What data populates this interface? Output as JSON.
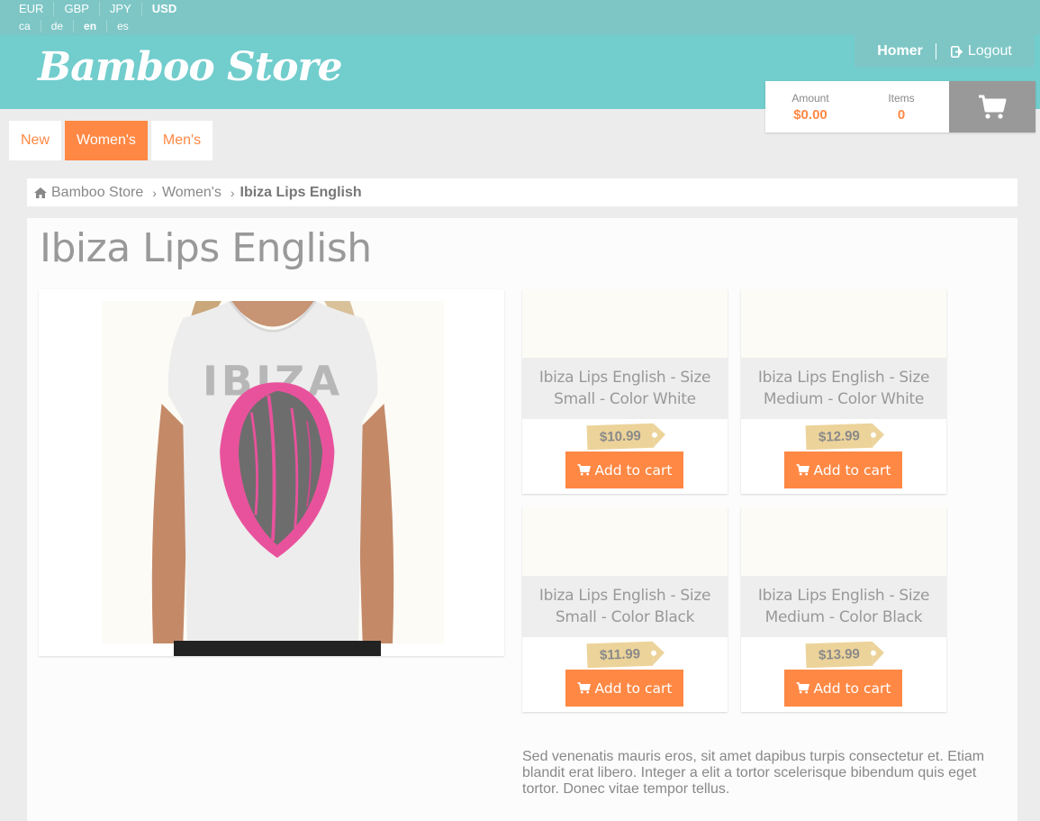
{
  "currencies": [
    {
      "label": "EUR",
      "active": false
    },
    {
      "label": "GBP",
      "active": false
    },
    {
      "label": "JPY",
      "active": false
    },
    {
      "label": "USD",
      "active": true
    }
  ],
  "languages": [
    {
      "label": "ca",
      "active": false
    },
    {
      "label": "de",
      "active": false
    },
    {
      "label": "en",
      "active": true
    },
    {
      "label": "es",
      "active": false
    }
  ],
  "header": {
    "logo": "Bamboo Store",
    "user": "Homer",
    "logout": "Logout"
  },
  "cart": {
    "amount_label": "Amount",
    "amount_value": "$0.00",
    "items_label": "Items",
    "items_value": "0",
    "icon": "shopping-cart-icon"
  },
  "nav": {
    "tabs": [
      {
        "label": "New",
        "active": false
      },
      {
        "label": "Women's",
        "active": true
      },
      {
        "label": "Men's",
        "active": false
      }
    ]
  },
  "breadcrumb": {
    "home": "Bamboo Store",
    "category": "Women's",
    "current": "Ibiza Lips English"
  },
  "product": {
    "title": "Ibiza Lips English",
    "description": "Sed venenatis mauris eros, sit amet dapibus turpis consectetur et. Etiam blandit erat libero. Integer a elit a tortor scelerisque bibendum quis eget tortor. Donec vitae tempor tellus.",
    "variants": [
      {
        "name": "Ibiza Lips English - Size Small - Color White",
        "price": "$10.99",
        "button": "Add to cart"
      },
      {
        "name": "Ibiza Lips English - Size Medium - Color White",
        "price": "$12.99",
        "button": "Add to cart"
      },
      {
        "name": "Ibiza Lips English - Size Small - Color Black",
        "price": "$11.99",
        "button": "Add to cart"
      },
      {
        "name": "Ibiza Lips English - Size Medium - Color Black",
        "price": "$13.99",
        "button": "Add to cart"
      }
    ]
  },
  "colors": {
    "accent": "#ff8844",
    "header": "#72cdcd",
    "topbar": "#7ec6c6",
    "price_tag": "#ecd39a"
  }
}
